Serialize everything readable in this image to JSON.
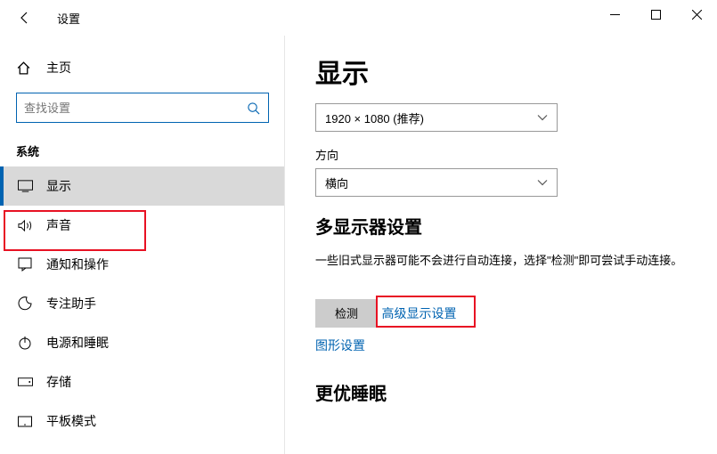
{
  "titlebar": {
    "title": "设置"
  },
  "sidebar": {
    "home": "主页",
    "search_placeholder": "查找设置",
    "section": "系统",
    "items": [
      {
        "label": "显示"
      },
      {
        "label": "声音"
      },
      {
        "label": "通知和操作"
      },
      {
        "label": "专注助手"
      },
      {
        "label": "电源和睡眠"
      },
      {
        "label": "存储"
      },
      {
        "label": "平板模式"
      }
    ]
  },
  "content": {
    "heading": "显示",
    "resolution": "1920 × 1080 (推荐)",
    "orientation_label": "方向",
    "orientation_value": "横向",
    "multi_heading": "多显示器设置",
    "multi_text": "一些旧式显示器可能不会进行自动连接，选择\"检测\"即可尝试手动连接。",
    "detect_btn": "检测",
    "adv_link": "高级显示设置",
    "graphics_link": "图形设置",
    "sleep_heading": "更优睡眠"
  }
}
